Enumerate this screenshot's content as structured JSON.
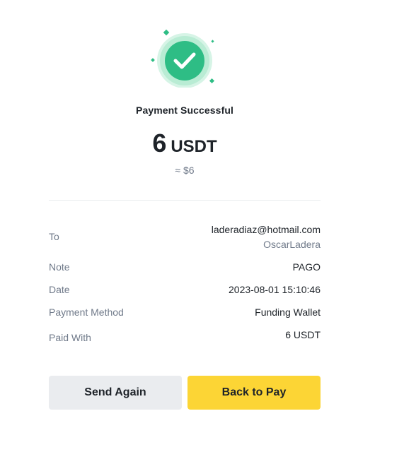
{
  "status": {
    "title": "Payment Successful",
    "icon": "check-circle-icon",
    "accent_color": "#2ebd85"
  },
  "amount": {
    "value": "6",
    "unit": "USDT",
    "fiat_approx": "≈ $6"
  },
  "details": {
    "to": {
      "label": "To",
      "email": "laderadiaz@hotmail.com",
      "name": "OscarLadera"
    },
    "note": {
      "label": "Note",
      "value": "PAGO"
    },
    "date": {
      "label": "Date",
      "value": "2023-08-01 15:10:46"
    },
    "payment_method": {
      "label": "Payment Method",
      "value": "Funding Wallet"
    },
    "paid_with": {
      "label": "Paid With",
      "value": "6 USDT"
    }
  },
  "actions": {
    "send_again_label": "Send Again",
    "back_to_pay_label": "Back to Pay",
    "primary_color": "#fcd535",
    "secondary_color": "#eaecef"
  }
}
